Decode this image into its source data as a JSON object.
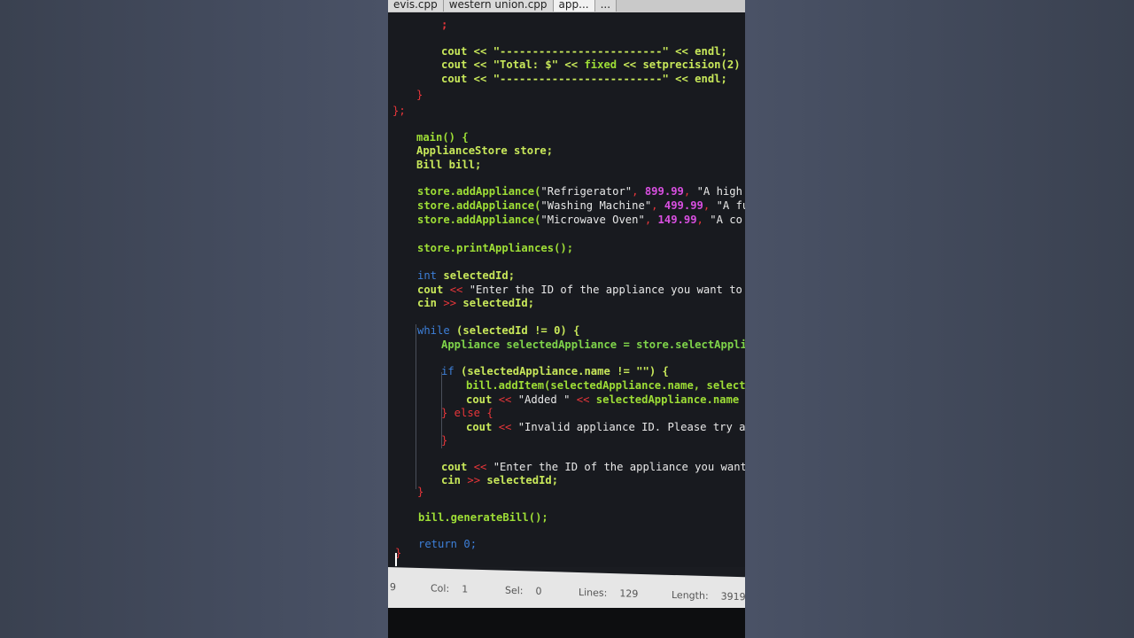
{
  "tabs": [
    {
      "label": "evis.cpp",
      "active": false
    },
    {
      "label": "western union.cpp",
      "active": false
    },
    {
      "label": "app...",
      "active": true
    },
    {
      "label": "...",
      "active": false
    }
  ],
  "code": {
    "l1": "cout << \"-------------------------\" << endl;",
    "l2_a": "cout << \"Total: $\" << ",
    "l2_b": "fixed",
    "l2_c": " << setprecision(2)",
    "l3": "cout << \"-------------------------\" << endl;",
    "close1": "}",
    "close2": "};",
    "main_sig": "main() {",
    "store_decl": "ApplianceStore store;",
    "bill_decl": "Bill bill;",
    "add1_call": "store.addAppliance(",
    "add1_str": "\"Refrigerator\"",
    "add1_num": "899.99",
    "add1_rest": "\"A high",
    "add2_call": "store.addAppliance(",
    "add2_str": "\"Washing Machine\"",
    "add2_num": "499.99",
    "add2_rest": "\"A fu",
    "add3_call": "store.addAppliance(",
    "add3_str": "\"Microwave Oven\"",
    "add3_num": "149.99",
    "add3_rest": "\"A co",
    "print_call": "store.printAppliances();",
    "int_kw": "int",
    "int_var": "selectedId;",
    "cout_prompt": "\"Enter the ID of the appliance you want to",
    "cin_line": "selectedId;",
    "while_kw": "while",
    "while_cond": "(selectedId != 0) {",
    "sel_decl": "Appliance selectedAppliance = store.selectAppli",
    "if_kw": "if",
    "if_cond": "(selectedAppliance.name != \"\") {",
    "additem": "bill.addItem(selectedAppliance.name, selecte",
    "added_str": "\"Added \"",
    "added_rest": "selectedAppliance.name",
    "else_line": "} else {",
    "invalid_str": "\"Invalid appliance ID. Please try ag",
    "close_inner": "}",
    "cout_prompt2": "\"Enter the ID of the appliance you want",
    "cin_line2": "selectedId;",
    "close_while": "}",
    "gen_bill": "bill.generateBill();",
    "return_kw": "return",
    "return_val": "0;",
    "close_main": "}"
  },
  "status": {
    "line_label": "9",
    "col_label": "Col:",
    "col_value": "1",
    "sel_label": "Sel:",
    "sel_value": "0",
    "lines_label": "Lines:",
    "lines_value": "129",
    "length_label": "Length:",
    "length_value": "3919"
  }
}
